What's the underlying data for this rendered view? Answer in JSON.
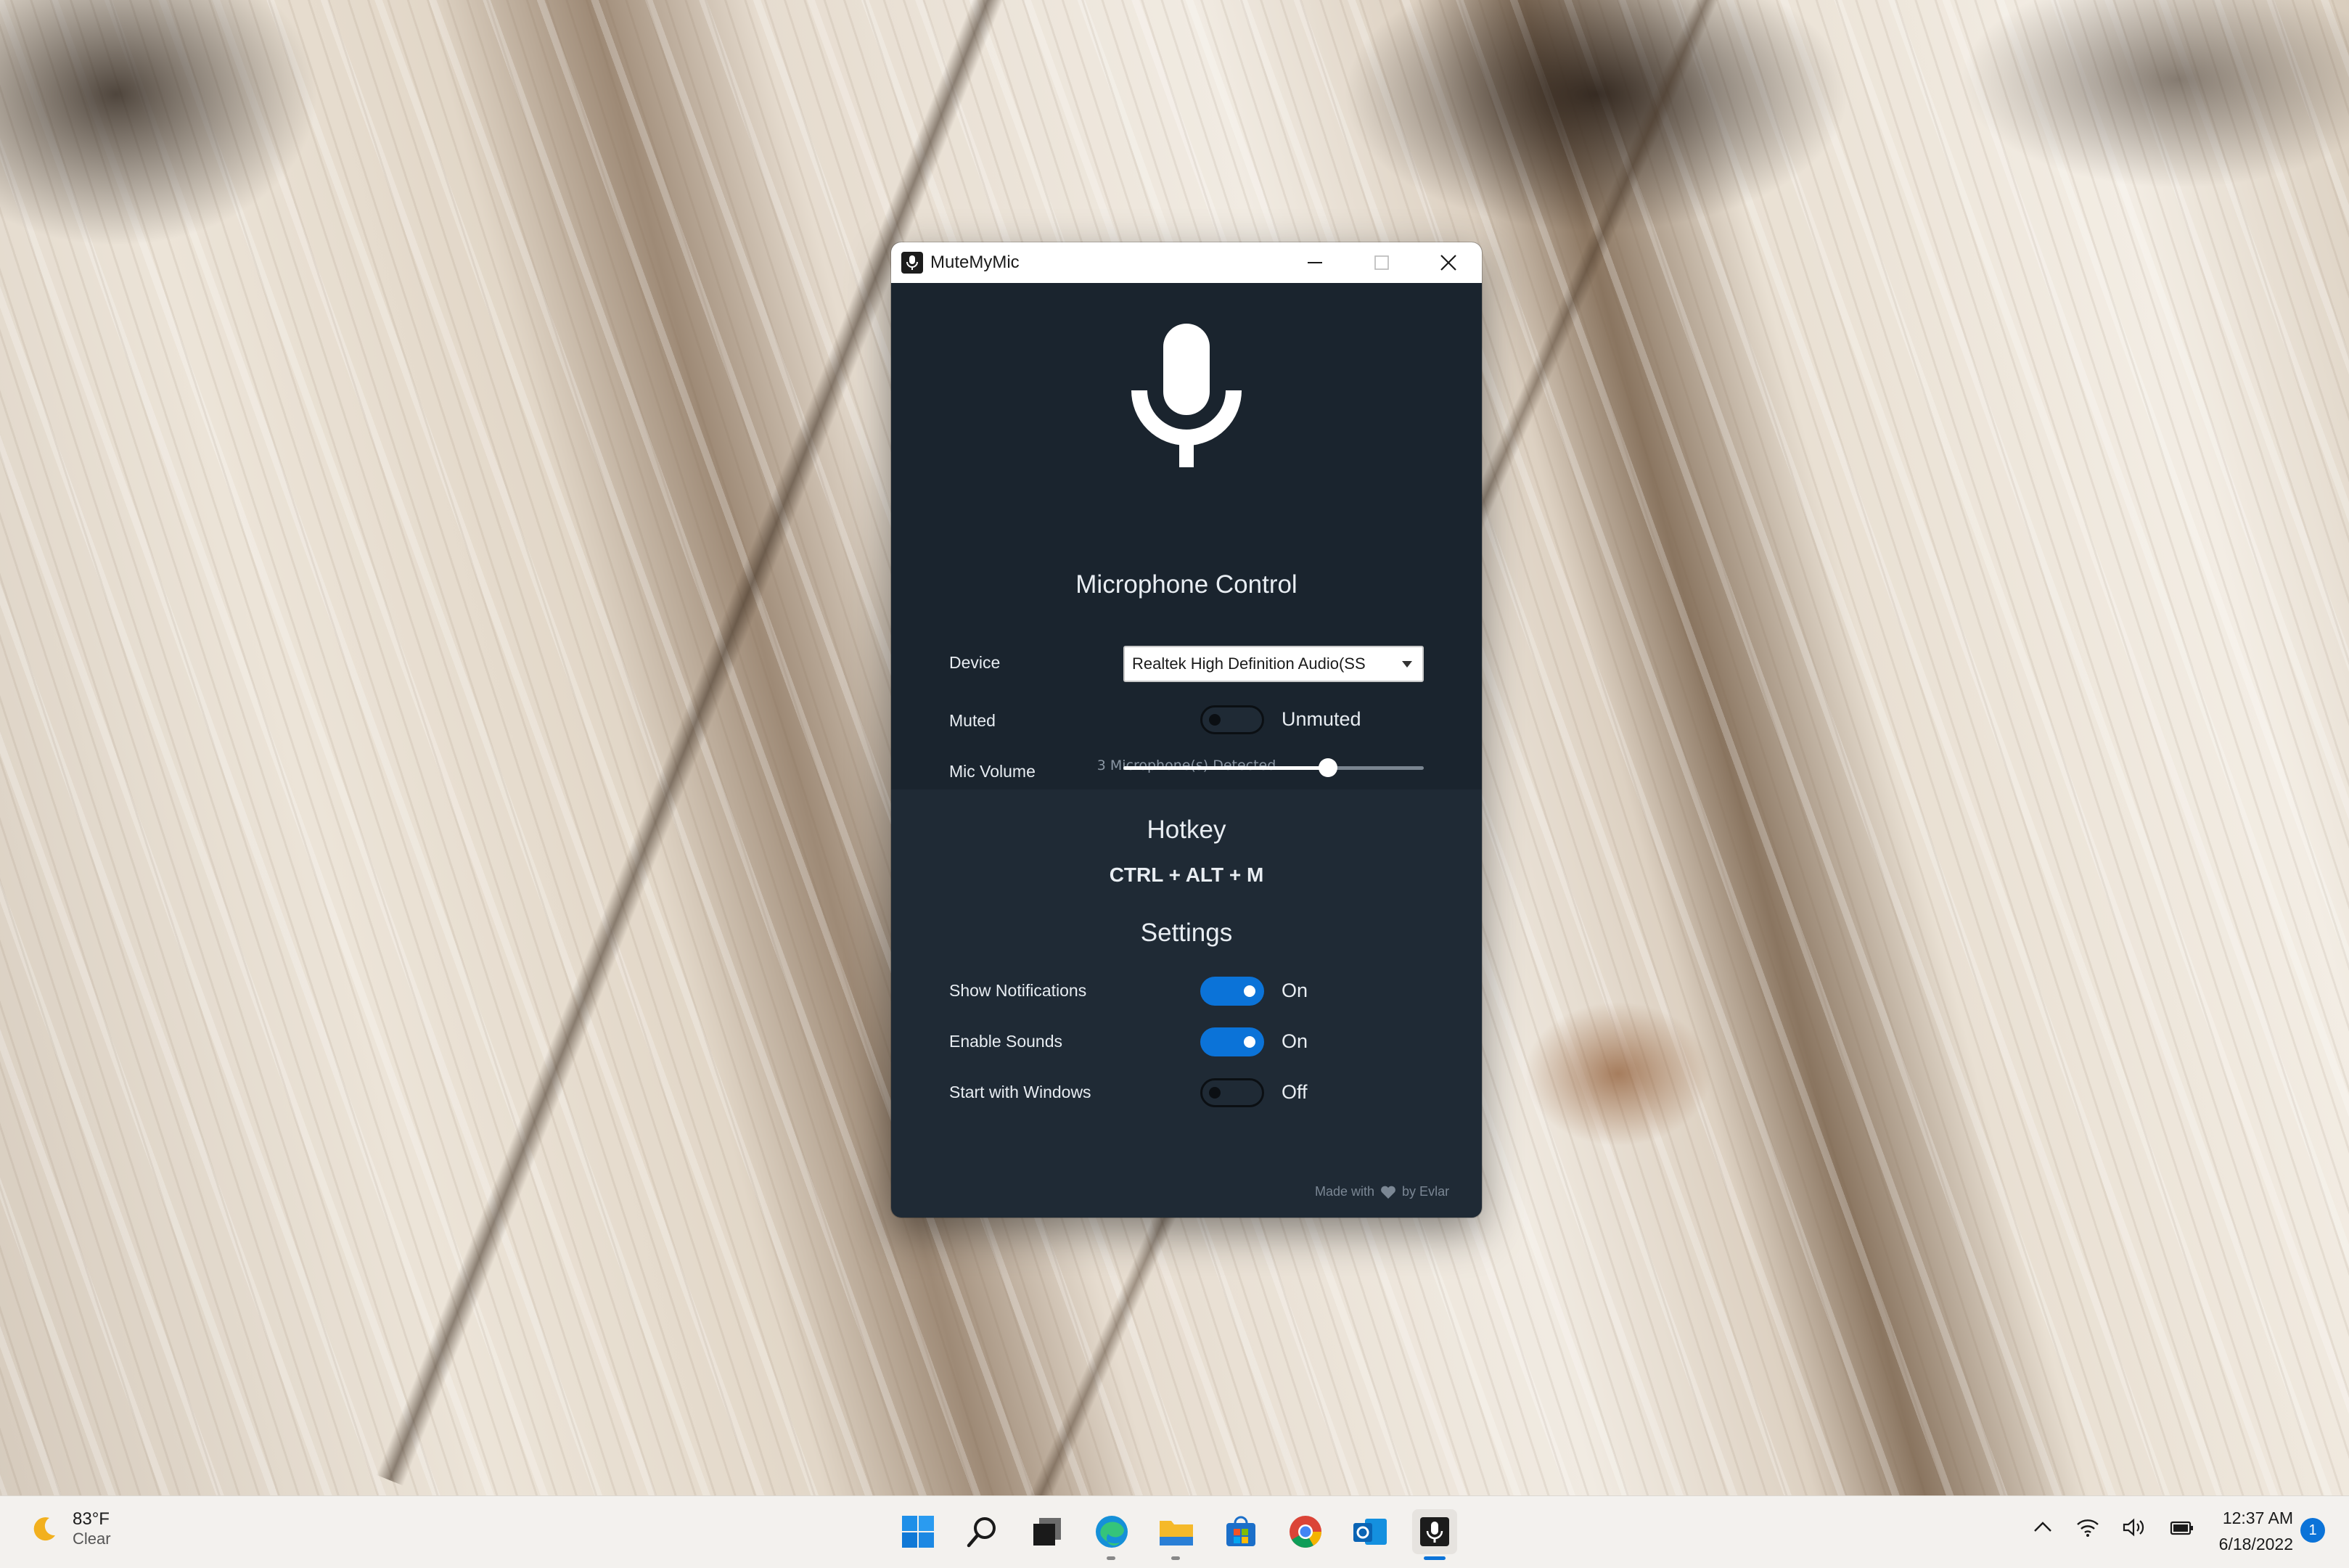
{
  "window": {
    "title": "MuteMyMic",
    "detected_text": "3 Microphone(s) Detected"
  },
  "microphone_control": {
    "title": "Microphone Control",
    "device_label": "Device",
    "device_value": "Realtek High Definition Audio(SS",
    "muted_label": "Muted",
    "muted_state": "Unmuted",
    "muted_on": false,
    "volume_label": "Mic Volume",
    "volume_fraction": 0.68
  },
  "hotkey": {
    "title": "Hotkey",
    "combo": "CTRL + ALT + M"
  },
  "settings": {
    "title": "Settings",
    "items": [
      {
        "label": "Show Notifications",
        "state": "On",
        "on": true
      },
      {
        "label": "Enable Sounds",
        "state": "On",
        "on": true
      },
      {
        "label": "Start with Windows",
        "state": "Off",
        "on": false
      }
    ]
  },
  "footer": {
    "made_with": "Made with",
    "by": "by Evlar"
  },
  "taskbar": {
    "weather_temp": "83°F",
    "weather_cond": "Clear",
    "time": "12:37 AM",
    "date": "6/18/2022",
    "notification_count": "1",
    "apps": [
      "start-icon",
      "search-icon",
      "task-view-icon",
      "edge-icon",
      "file-explorer-icon",
      "store-icon",
      "chrome-icon",
      "outlook-icon",
      "mutemymic-icon"
    ]
  },
  "colors": {
    "accent": "#0b73d8",
    "panel": "#1f2a35",
    "hero": "#1a242e"
  }
}
